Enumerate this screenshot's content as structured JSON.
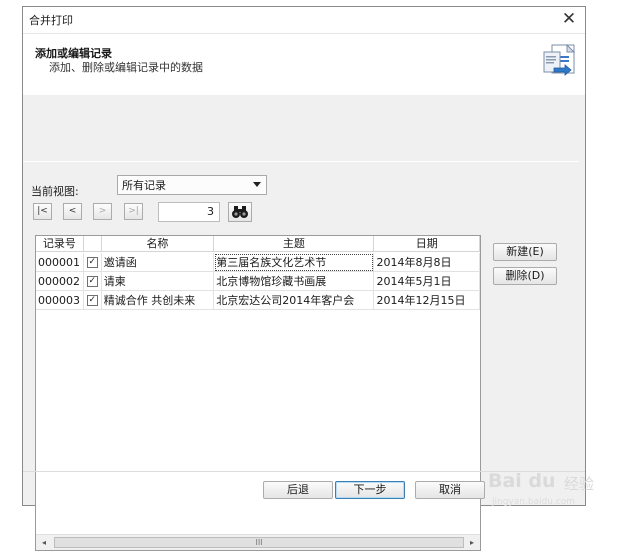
{
  "window": {
    "title": "合并打印",
    "close_glyph": "✕"
  },
  "header": {
    "title": "添加或编辑记录",
    "subtitle": "添加、删除或编辑记录中的数据",
    "icon": "merge-document-icon"
  },
  "view": {
    "label": "当前视图:",
    "selected": "所有记录"
  },
  "navigation": {
    "first": "|<",
    "prev": "<",
    "next": ">",
    "last": ">|",
    "current_record": "3",
    "find_icon": "binoculars-icon"
  },
  "grid": {
    "columns": [
      "记录号",
      "",
      "名称",
      "主题",
      "日期"
    ],
    "rows": [
      {
        "id": "000001",
        "checked": true,
        "check_glyph": "✓",
        "name": "邀请函",
        "subject": "第三届名族文化艺术节",
        "date": "2014年8月8日"
      },
      {
        "id": "000002",
        "checked": true,
        "check_glyph": "✓",
        "name": "请柬",
        "subject": "北京博物馆珍藏书画展",
        "date": "2014年5月1日"
      },
      {
        "id": "000003",
        "checked": true,
        "check_glyph": "✓",
        "name": "精诚合作 共创未来",
        "subject": "北京宏达公司2014年客户会",
        "date": "2014年12月15日"
      }
    ],
    "scroll_left": "◂",
    "scroll_right": "▸",
    "scroll_thumb_grip": "III"
  },
  "side_buttons": {
    "new": "新建(E)",
    "delete": "删除(D)"
  },
  "footer": {
    "back": "后退",
    "next": "下一步",
    "cancel": "取消"
  },
  "watermark": {
    "logo": "Bai du",
    "text": "经验",
    "url": "jingyan.baidu.com"
  },
  "colors": {
    "dialog_bg": "#f0f0f0",
    "header_bg": "#ffffff",
    "default_button_border": "#3c7fb1"
  }
}
